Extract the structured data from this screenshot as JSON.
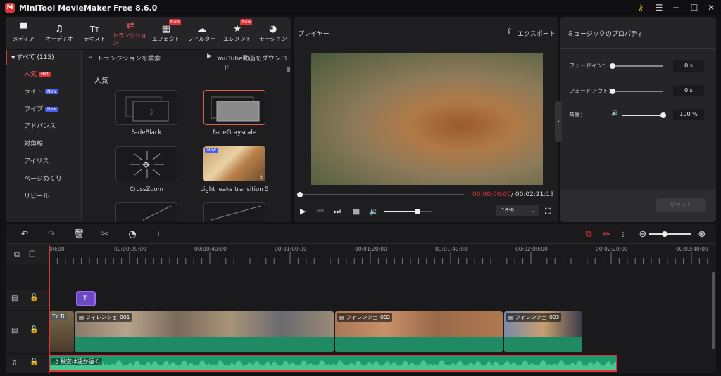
{
  "app": {
    "title": "MiniTool MovieMaker Free 8.6.0"
  },
  "toolbar": {
    "items": [
      {
        "label": "メディア",
        "icon": "folder-icon"
      },
      {
        "label": "オーディオ",
        "icon": "music-note-icon"
      },
      {
        "label": "テキスト",
        "icon": "text-icon"
      },
      {
        "label": "トランジション",
        "icon": "transition-icon",
        "active": true
      },
      {
        "label": "エフェクト",
        "icon": "effect-icon",
        "badge": "New"
      },
      {
        "label": "フィルター",
        "icon": "filter-icon"
      },
      {
        "label": "エレメント",
        "icon": "element-icon",
        "badge": "New"
      },
      {
        "label": "モーション",
        "icon": "motion-icon"
      }
    ]
  },
  "library": {
    "all_label": "すべて (115)",
    "categories": [
      {
        "label": "人気",
        "tag": "Hot"
      },
      {
        "label": "ライト",
        "tag": "New"
      },
      {
        "label": "ワイプ",
        "tag": "New"
      },
      {
        "label": "アドバンス"
      },
      {
        "label": "対角線"
      },
      {
        "label": "アイリス"
      },
      {
        "label": "ページめくり"
      },
      {
        "label": "リビール"
      }
    ],
    "search_placeholder": "トランジションを検索",
    "youtube_link": "YouTube動画をダウンロード",
    "section_title": "人気",
    "items": [
      {
        "name": "FadeBlack"
      },
      {
        "name": "FadeGrayscale",
        "selected": true
      },
      {
        "name": "CrossZoom"
      },
      {
        "name": "Light leaks transition 5",
        "badge": "New"
      }
    ]
  },
  "player": {
    "title": "プレイヤー",
    "export_label": "エクスポート",
    "current_time": "00:00:00:00",
    "total_time": " / 00:02:21:13",
    "volume": 0.7,
    "aspect_ratio": "16:9"
  },
  "properties": {
    "title": "ミュージックのプロパティ",
    "fade_in_label": "フェードイン：",
    "fade_in_value": "0 s",
    "fade_out_label": "フェードアウト：",
    "fade_out_value": "0 s",
    "volume_label": "音量：",
    "volume_value": "100 %",
    "reset_label": "リセット"
  },
  "timeline": {
    "ticks": [
      "00:00",
      "00:00:20:00",
      "00:00:40:00",
      "00:01:00:00",
      "00:01:20:00",
      "00:01:40:00",
      "00:02:00:00",
      "00:02:20:00",
      "00:02:40:00"
    ],
    "text_clip_icon": "Tr",
    "clips": [
      {
        "label": "フィレンツェ_001"
      },
      {
        "label": "フィレンツェ_002"
      },
      {
        "label": "フィレンツェ_003"
      }
    ],
    "title_clip_label": "Tт Ti",
    "audio_clip_label": "秋空は遥か遠く"
  },
  "colors": {
    "accent": "#e0343a",
    "video_track": "#1f8a63",
    "audio_track": "#1c9b6c"
  }
}
